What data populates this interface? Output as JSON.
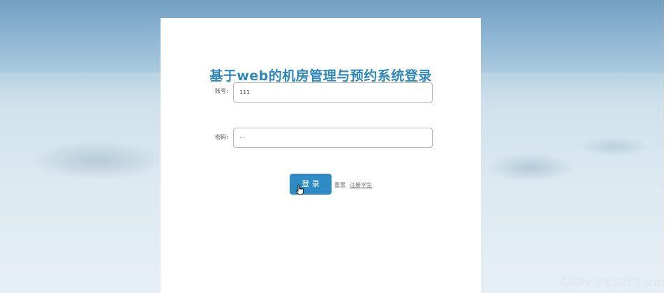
{
  "login": {
    "title": "基于web的机房管理与预约系统登录",
    "username_label": "账号:",
    "username_value": "111",
    "password_label": "密码:",
    "password_value": "···",
    "login_button": "登 录",
    "reset_link": "重置",
    "register_link": "注册学生"
  },
  "watermark": "CSDN @笔文程序设计",
  "colors": {
    "title": "#2f86b9",
    "button": "#2f8bc4",
    "panel": "#ffffff"
  }
}
